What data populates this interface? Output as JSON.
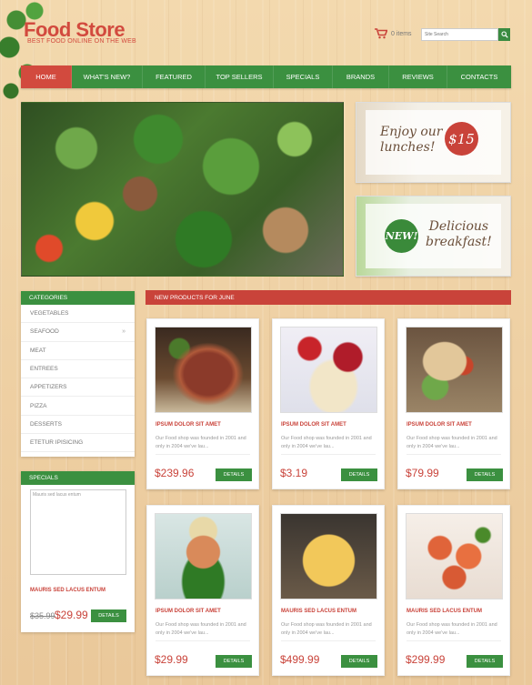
{
  "header": {
    "logo_title": "Food Store",
    "logo_tagline": "BEST FOOD ONLINE ON THE WEB",
    "cart_count": "0 items",
    "search_placeholder": "Site Search"
  },
  "nav": [
    {
      "label": "HOME",
      "active": true
    },
    {
      "label": "WHAT'S NEW?"
    },
    {
      "label": "FEATURED"
    },
    {
      "label": "TOP SELLERS"
    },
    {
      "label": "SPECIALS"
    },
    {
      "label": "BRANDS"
    },
    {
      "label": "REVIEWS"
    },
    {
      "label": "CONTACTS"
    }
  ],
  "banners": {
    "lunch": {
      "text_line1": "Enjoy our",
      "text_line2": "lunches!",
      "price": "$15"
    },
    "breakfast": {
      "badge": "NEW!",
      "text_line1": "Delicious",
      "text_line2": "breakfast!"
    }
  },
  "categories": {
    "title": "CATEGORIES",
    "items": [
      "VEGETABLES",
      "SEAFOOD",
      "MEAT",
      "ENTREES",
      "APPETIZERS",
      "PIZZA",
      "DESSERTS",
      "ETETUR IPISICING"
    ],
    "arrow": "»"
  },
  "specials": {
    "title": "SPECIALS",
    "image_alt": "Mauris sed lacus entum",
    "name": "MAURIS SED LACUS ENTUM",
    "old_price": "$35.99",
    "new_price": "$29.99",
    "details_label": "DETAILS"
  },
  "products": {
    "title": "NEW PRODUCTS FOR JUNE",
    "details_label": "DETAILS",
    "items": [
      {
        "name": "IPSUM DOLOR SIT AMET",
        "desc": "Our Food shop was founded in 2001 and only in 2004 we've lau...",
        "price": "$239.96"
      },
      {
        "name": "IPSUM DOLOR SIT AMET",
        "desc": "Our Food shop was founded in 2001 and only in 2004 we've lau...",
        "price": "$3.19"
      },
      {
        "name": "IPSUM DOLOR SIT AMET",
        "desc": "Our Food shop was founded in 2001 and only in 2004 we've lau...",
        "price": "$79.99"
      },
      {
        "name": "IPSUM DOLOR SIT AMET",
        "desc": "Our Food shop was founded in 2001 and only in 2004 we've lau...",
        "price": "$29.99"
      },
      {
        "name": "MAURIS SED LACUS ENTUM",
        "desc": "Our Food shop was founded in 2001 and only in 2004 we've lau...",
        "price": "$499.99"
      },
      {
        "name": "MAURIS SED LACUS ENTUM",
        "desc": "Our Food shop was founded in 2001 and only in 2004 we've lau...",
        "price": "$299.99"
      }
    ]
  },
  "colors": {
    "accent_red": "#c9433a",
    "accent_green": "#3b9040"
  }
}
